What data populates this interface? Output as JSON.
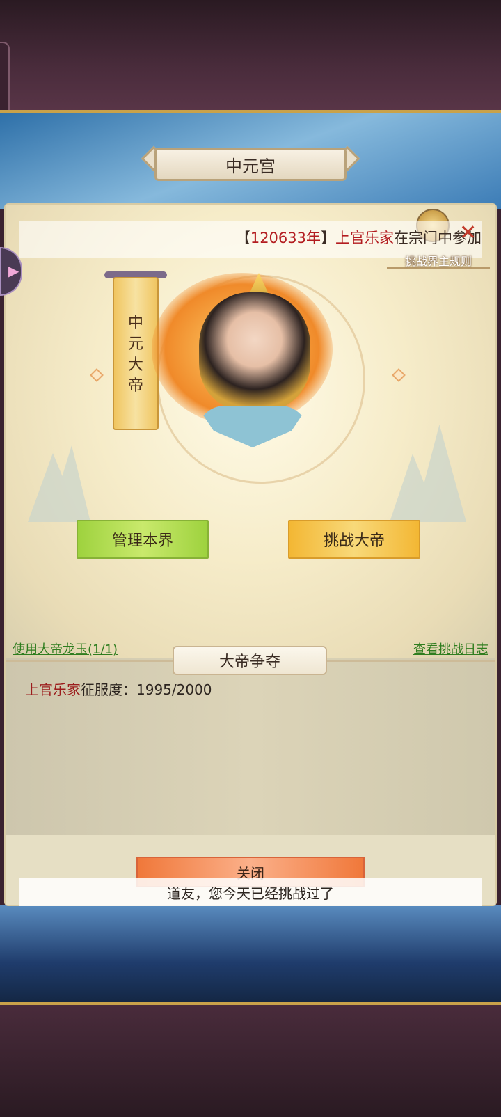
{
  "header": {
    "title": "中元宫"
  },
  "marquee": {
    "prefix": "【",
    "year": "120633年",
    "suffix": "】",
    "player": "上官乐家",
    "message": "在宗门中参加"
  },
  "rules": {
    "label": "挑战界主规则"
  },
  "banner": {
    "text": "中元大帝"
  },
  "actions": {
    "manage_label": "管理本界",
    "challenge_label": "挑战大帝"
  },
  "links": {
    "use_jade": "使用大帝龙玉(1/1)",
    "view_log": "查看挑战日志"
  },
  "section": {
    "title": "大帝争夺"
  },
  "conquest": {
    "player": "上官乐家",
    "label": "征服度：",
    "value": "1995/2000"
  },
  "footer": {
    "close_label": "关闭",
    "toast": "道友，您今天已经挑战过了"
  },
  "icons": [
    "close-icon",
    "rules-medal-icon",
    "diamond-ornament-icon"
  ]
}
